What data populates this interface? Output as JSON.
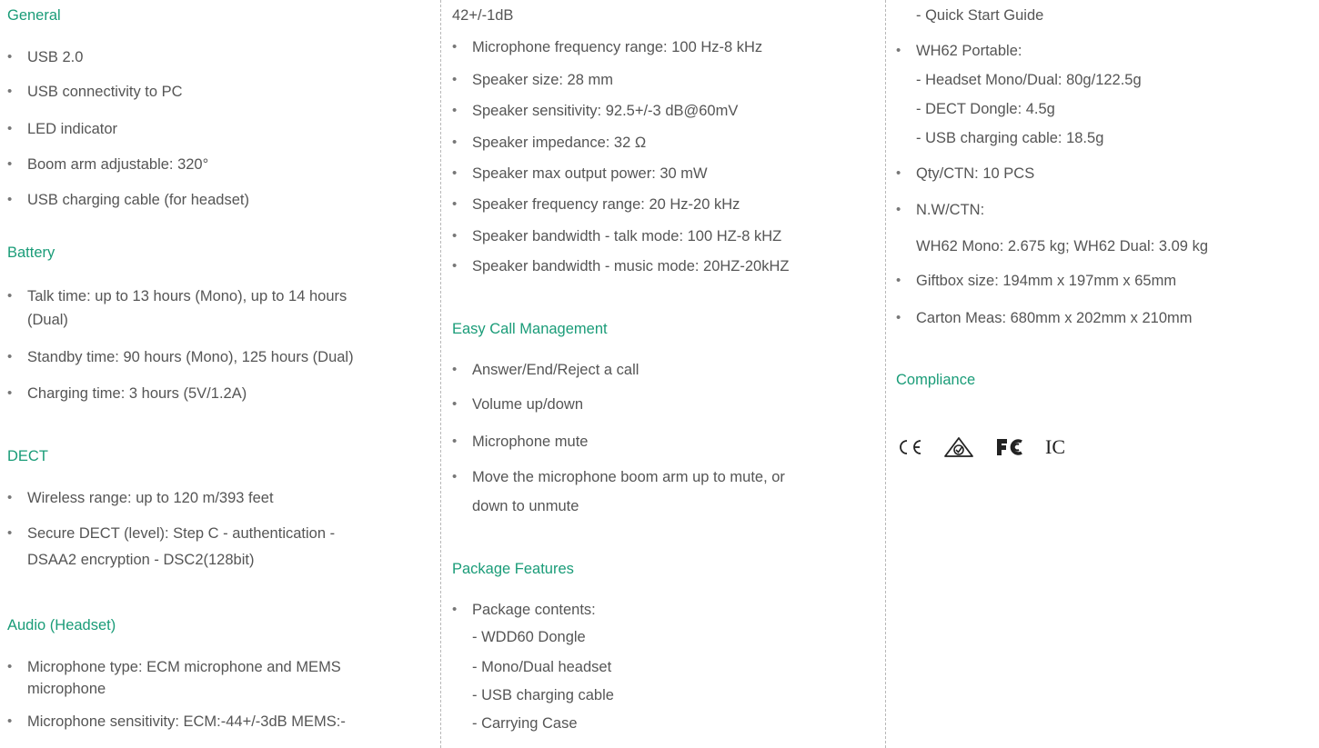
{
  "column1": {
    "general": {
      "heading": "General",
      "items": [
        "USB 2.0",
        "USB connectivity to PC",
        "LED indicator",
        "Boom arm adjustable: 320°",
        "USB charging cable (for headset)"
      ]
    },
    "battery": {
      "heading": "Battery",
      "items": [
        [
          "Talk time: up to 13 hours (Mono), up to 14 hours",
          "(Dual)"
        ],
        "Standby time: 90 hours (Mono), 125 hours (Dual)",
        "Charging time: 3 hours (5V/1.2A)"
      ]
    },
    "dect": {
      "heading": "DECT",
      "items": [
        "Wireless range: up to 120 m/393 feet",
        [
          "Secure DECT (level): Step C - authentication -",
          "DSAA2 encryption - DSC2(128bit)"
        ]
      ]
    },
    "audio": {
      "heading": "Audio (Headset)",
      "items": [
        [
          "Microphone type: ECM microphone and MEMS",
          "microphone"
        ],
        "Microphone sensitivity: ECM:-44+/-3dB MEMS:-"
      ]
    }
  },
  "column2": {
    "audio_cont": {
      "first_line": "42+/-1dB",
      "items": [
        "Microphone frequency range: 100 Hz-8 kHz",
        "Speaker size: 28 mm",
        "Speaker sensitivity: 92.5+/-3 dB@60mV",
        "Speaker impedance: 32 Ω",
        "Speaker max output power: 30 mW",
        "Speaker frequency range: 20 Hz-20 kHz",
        "Speaker bandwidth - talk mode: 100 HZ-8 kHZ",
        "Speaker bandwidth - music mode: 20HZ-20kHZ"
      ]
    },
    "call": {
      "heading": "Easy Call Management",
      "items": [
        "Answer/End/Reject a call",
        "Volume up/down",
        "Microphone mute",
        [
          "Move the microphone boom arm up to mute, or",
          "down to unmute"
        ]
      ]
    },
    "package": {
      "heading": "Package Features",
      "items": [
        [
          "Package contents:",
          "- WDD60 Dongle",
          "- Mono/Dual headset",
          "- USB charging cable",
          "- Carrying Case"
        ]
      ]
    }
  },
  "column3": {
    "package_cont": {
      "first_line": "- Quick Start Guide",
      "items": [
        [
          "WH62 Portable:",
          "- Headset Mono/Dual: 80g/122.5g",
          "- DECT Dongle: 4.5g",
          "- USB charging cable: 18.5g"
        ],
        "Qty/CTN: 10 PCS",
        "N.W/CTN:",
        "Giftbox size: 194mm x 197mm x 65mm",
        "Carton Meas: 680mm x 202mm x 210mm"
      ],
      "nw_value": "WH62 Mono: 2.675 kg; WH62 Dual: 3.09 kg"
    },
    "compliance": {
      "heading": "Compliance",
      "logos": [
        "ce-mark-icon",
        "rcm-mark-icon",
        "fcc-logo-icon",
        "ic-mark-icon"
      ],
      "ic_text": "IC"
    }
  },
  "colors": {
    "heading": "#1a9c78",
    "text": "#555555",
    "divider": "#b8b8b8"
  }
}
